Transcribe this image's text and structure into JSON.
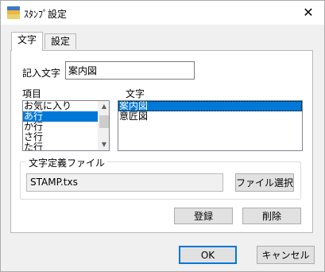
{
  "window": {
    "title": "ｽﾀﾝﾌﾟ設定",
    "close_glyph": "✕"
  },
  "tabs": [
    {
      "label": "文字",
      "active": true
    },
    {
      "label": "設定",
      "active": false
    }
  ],
  "entry": {
    "label": "記入文字",
    "value": "案内図"
  },
  "category_list": {
    "label": "項目",
    "items": [
      "お気に入り",
      "あ行",
      "か行",
      "さ行",
      "た行"
    ],
    "selected_index": 1
  },
  "text_list": {
    "label": "文字",
    "items": [
      "案内図",
      "意匠図"
    ],
    "selected_index": 0
  },
  "definition_file": {
    "group_label": "文字定義ファイル",
    "filename": "STAMP.txs",
    "select_button": "ファイル選択"
  },
  "actions": {
    "register": "登録",
    "delete": "削除"
  },
  "dialog_buttons": {
    "ok": "OK",
    "cancel": "キャンセル"
  },
  "colors": {
    "selection": "#0078d7",
    "panel_bg": "#ffffff",
    "window_bg": "#f0f0f0"
  }
}
